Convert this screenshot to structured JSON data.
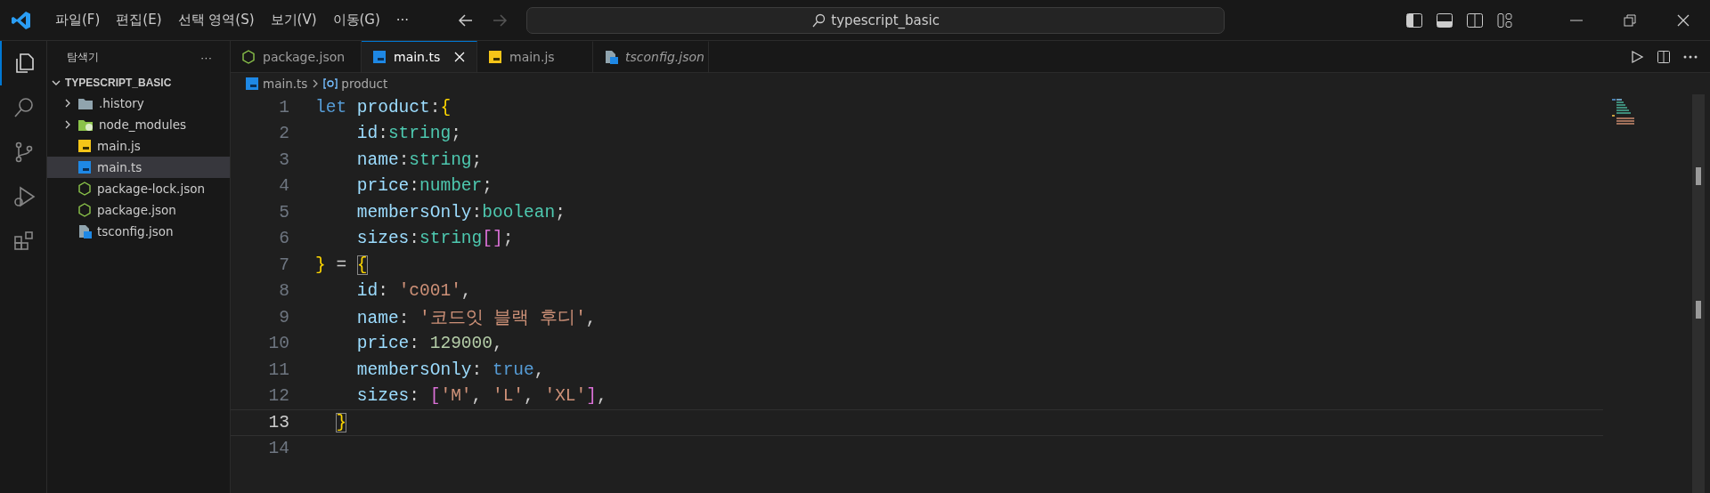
{
  "menu": [
    "파일(F)",
    "편집(E)",
    "선택 영역(S)",
    "보기(V)",
    "이동(G)",
    "···"
  ],
  "search": {
    "value": "typescript_basic"
  },
  "activity_bar": [
    {
      "kind": "explorer",
      "selected": true
    },
    {
      "kind": "search",
      "selected": false
    },
    {
      "kind": "source-control",
      "selected": false
    },
    {
      "kind": "run-debug",
      "selected": false
    },
    {
      "kind": "extensions",
      "selected": false
    }
  ],
  "sidebar": {
    "title": "탐색기",
    "more": "···",
    "root": {
      "label": "TYPESCRIPT_BASIC",
      "expanded": true,
      "children": [
        {
          "label": ".history",
          "kind": "folder",
          "expanded": false,
          "selected": false
        },
        {
          "label": "node_modules",
          "kind": "node-folder",
          "expanded": false,
          "selected": false
        },
        {
          "label": "main.js",
          "kind": "js",
          "selected": false
        },
        {
          "label": "main.ts",
          "kind": "ts",
          "selected": true
        },
        {
          "label": "package-lock.json",
          "kind": "node-json",
          "selected": false
        },
        {
          "label": "package.json",
          "kind": "node-json",
          "selected": false
        },
        {
          "label": "tsconfig.json",
          "kind": "ts-config",
          "selected": false
        }
      ]
    }
  },
  "tabs": [
    {
      "label": "package.json",
      "kind": "node-json",
      "selected": false,
      "italic": false
    },
    {
      "label": "main.ts",
      "kind": "ts",
      "selected": true,
      "italic": false
    },
    {
      "label": "main.js",
      "kind": "js",
      "selected": false,
      "italic": false
    },
    {
      "label": "tsconfig.json",
      "kind": "ts-config",
      "selected": false,
      "italic": true
    }
  ],
  "breadcrumb": [
    "main.ts",
    "product"
  ],
  "lines": [
    {
      "number": "1",
      "selected": false,
      "tokens": [
        {
          "kind": "keyword",
          "text": "let"
        },
        {
          "kind": "var",
          "text": " product"
        },
        {
          "kind": "plain",
          "text": ":"
        },
        {
          "kind": "bracket",
          "text": "{"
        }
      ]
    },
    {
      "number": "2",
      "selected": false,
      "tokens": [
        {
          "kind": "var",
          "text": "    id"
        },
        {
          "kind": "plain",
          "text": ":"
        },
        {
          "kind": "type",
          "text": "string"
        },
        {
          "kind": "plain",
          "text": ";"
        }
      ]
    },
    {
      "number": "3",
      "selected": false,
      "tokens": [
        {
          "kind": "var",
          "text": "    name"
        },
        {
          "kind": "plain",
          "text": ":"
        },
        {
          "kind": "type",
          "text": "string"
        },
        {
          "kind": "plain",
          "text": ";"
        }
      ]
    },
    {
      "number": "4",
      "selected": false,
      "tokens": [
        {
          "kind": "var",
          "text": "    price"
        },
        {
          "kind": "plain",
          "text": ":"
        },
        {
          "kind": "type",
          "text": "number"
        },
        {
          "kind": "plain",
          "text": ";"
        }
      ]
    },
    {
      "number": "5",
      "selected": false,
      "tokens": [
        {
          "kind": "var",
          "text": "    membersOnly"
        },
        {
          "kind": "plain",
          "text": ":"
        },
        {
          "kind": "type",
          "text": "boolean"
        },
        {
          "kind": "plain",
          "text": ";"
        }
      ]
    },
    {
      "number": "6",
      "selected": false,
      "tokens": [
        {
          "kind": "var",
          "text": "    sizes"
        },
        {
          "kind": "plain",
          "text": ":"
        },
        {
          "kind": "type",
          "text": "string"
        },
        {
          "kind": "bracket2",
          "text": "[]"
        },
        {
          "kind": "plain",
          "text": ";"
        }
      ]
    },
    {
      "number": "7",
      "selected": false,
      "tokens": [
        {
          "kind": "bracket",
          "text": "}"
        },
        {
          "kind": "plain",
          "text": " = "
        },
        {
          "kind": "bracket-match",
          "text": "{"
        }
      ]
    },
    {
      "number": "8",
      "selected": false,
      "tokens": [
        {
          "kind": "var",
          "text": "    id"
        },
        {
          "kind": "plain",
          "text": ": "
        },
        {
          "kind": "string",
          "text": "'c001'"
        },
        {
          "kind": "plain",
          "text": ","
        }
      ]
    },
    {
      "number": "9",
      "selected": false,
      "tokens": [
        {
          "kind": "var",
          "text": "    name"
        },
        {
          "kind": "plain",
          "text": ": "
        },
        {
          "kind": "string",
          "text": "'코드잇 블랙 후디'"
        },
        {
          "kind": "plain",
          "text": ","
        }
      ]
    },
    {
      "number": "10",
      "selected": false,
      "tokens": [
        {
          "kind": "var",
          "text": "    price"
        },
        {
          "kind": "plain",
          "text": ": "
        },
        {
          "kind": "number",
          "text": "129000"
        },
        {
          "kind": "plain",
          "text": ","
        }
      ]
    },
    {
      "number": "11",
      "selected": false,
      "tokens": [
        {
          "kind": "var",
          "text": "    membersOnly"
        },
        {
          "kind": "plain",
          "text": ": "
        },
        {
          "kind": "keyword",
          "text": "true"
        },
        {
          "kind": "plain",
          "text": ","
        }
      ]
    },
    {
      "number": "12",
      "selected": false,
      "tokens": [
        {
          "kind": "var",
          "text": "    sizes"
        },
        {
          "kind": "plain",
          "text": ": "
        },
        {
          "kind": "bracket2",
          "text": "["
        },
        {
          "kind": "string",
          "text": "'M'"
        },
        {
          "kind": "plain",
          "text": ", "
        },
        {
          "kind": "string",
          "text": "'L'"
        },
        {
          "kind": "plain",
          "text": ", "
        },
        {
          "kind": "string",
          "text": "'XL'"
        },
        {
          "kind": "bracket2",
          "text": "]"
        },
        {
          "kind": "plain",
          "text": ","
        }
      ]
    },
    {
      "number": "13",
      "selected": true,
      "tokens": [
        {
          "kind": "bracket-match",
          "text": "  }"
        }
      ]
    },
    {
      "number": "14",
      "selected": false
    }
  ]
}
